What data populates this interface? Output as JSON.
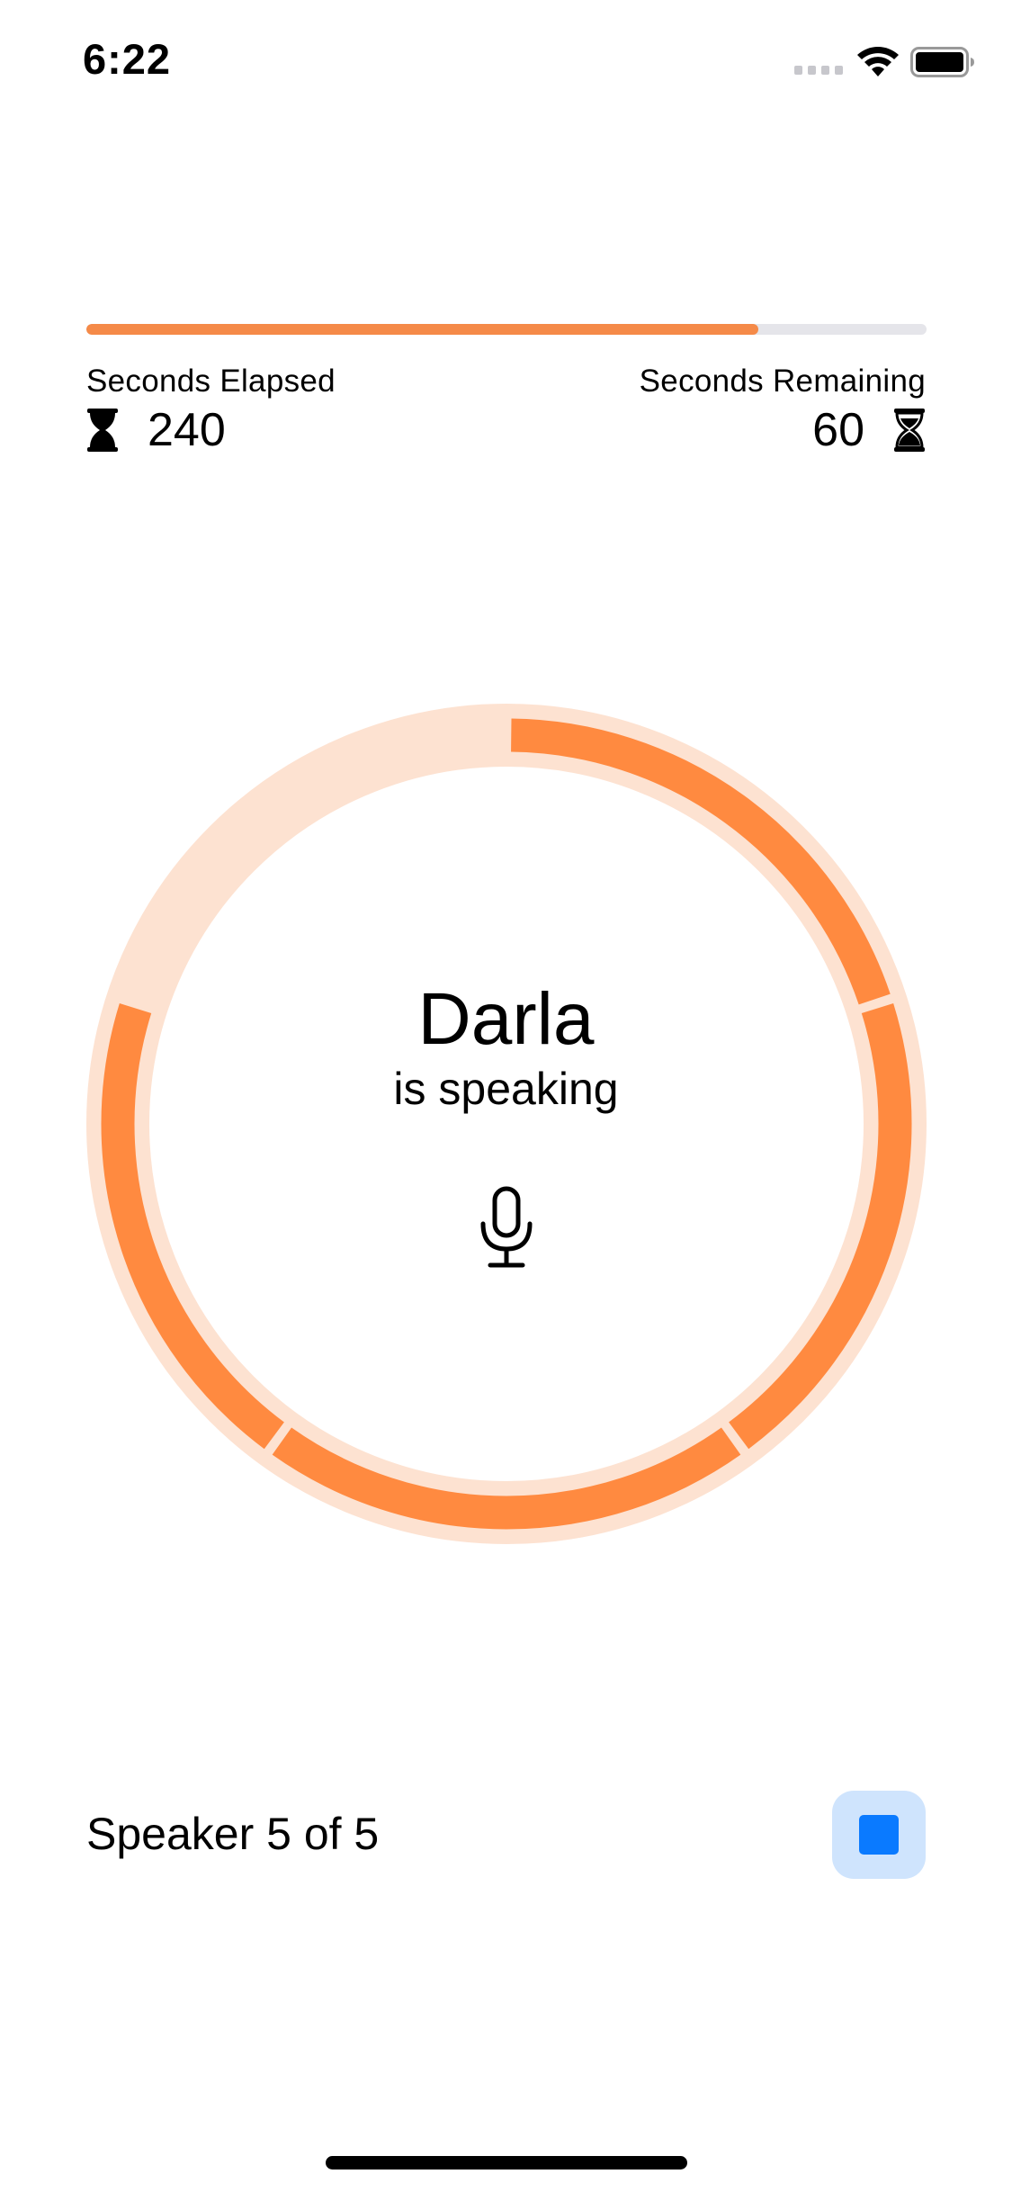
{
  "status_bar": {
    "time": "6:22",
    "icons": [
      "cellular-signal-icon",
      "wifi-icon",
      "battery-icon"
    ]
  },
  "progress": {
    "fraction": 0.8,
    "fill_color": "#f58a48",
    "track_color": "#e5e5ea",
    "elapsed_label": "Seconds Elapsed",
    "elapsed_value": "240",
    "remaining_label": "Seconds Remaining",
    "remaining_value": "60"
  },
  "speaker_ring": {
    "segment_count": 5,
    "completed_segments": 4,
    "segment_color": "#ff8a40",
    "background_color": "#fde2d1"
  },
  "current_speaker": {
    "name": "Darla",
    "status": "is speaking",
    "icon": "microphone-icon"
  },
  "footer": {
    "speaker_count": "Speaker 5 of 5",
    "stop_button_icon": "stop-icon",
    "accent_color": "#0a7aff"
  }
}
